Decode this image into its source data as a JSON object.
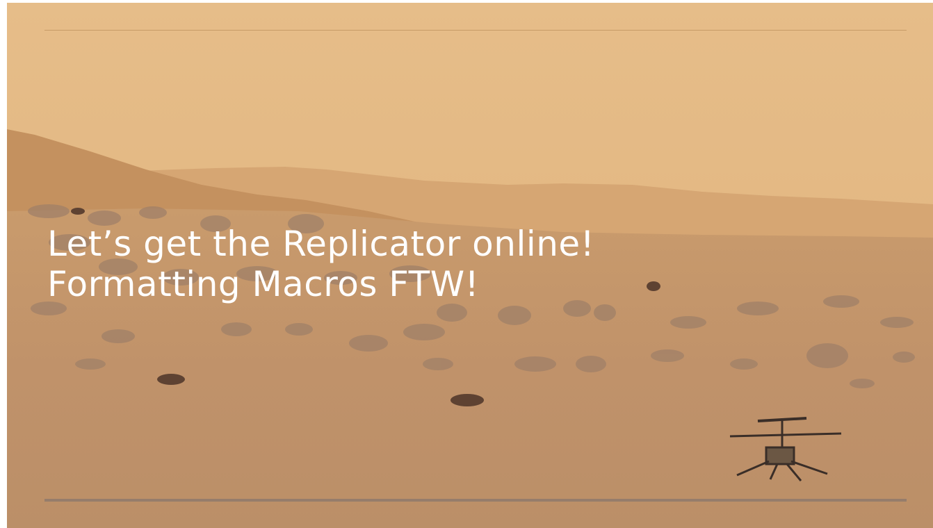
{
  "slide": {
    "title_lines": [
      "Let’s get the Replicator online!",
      "Formatting Macros FTW!"
    ]
  },
  "colors": {
    "sky": "#e3b985",
    "far_hills": "#d7a874",
    "ground": "#c49467",
    "rocks": "#a0826a",
    "title_text": "#ffffff",
    "bottom_rule": "#8f7a6c"
  },
  "icons": {
    "helicopter": "helicopter-icon"
  }
}
